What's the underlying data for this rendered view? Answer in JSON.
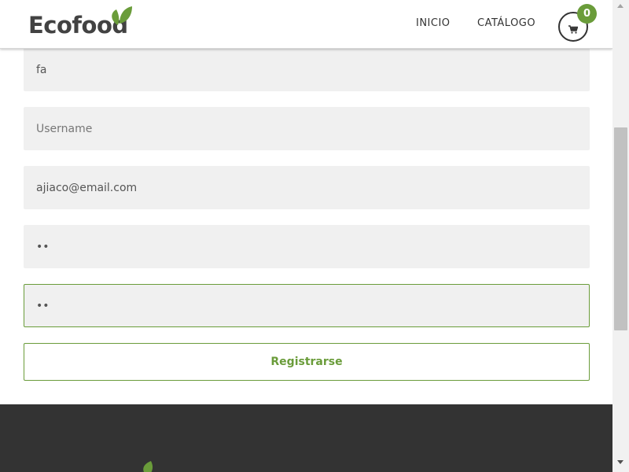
{
  "header": {
    "brand": "Ecofood",
    "nav": [
      {
        "label": "INICIO"
      },
      {
        "label": "CATÁLOGO"
      }
    ],
    "cart_count": "0"
  },
  "form": {
    "first_name_value": "fa",
    "last_name_value": "fa",
    "username_placeholder": "Username",
    "email_value": "ajiaco@email.com",
    "password_value": "••",
    "confirm_password_value": "••",
    "submit_label": "Registrarse"
  },
  "colors": {
    "accent": "#6a9c3a",
    "text_dark": "#424242",
    "footer_bg": "#333333",
    "field_bg": "#f0f0f0"
  },
  "icons": [
    "leaf-icon",
    "cart-icon"
  ]
}
